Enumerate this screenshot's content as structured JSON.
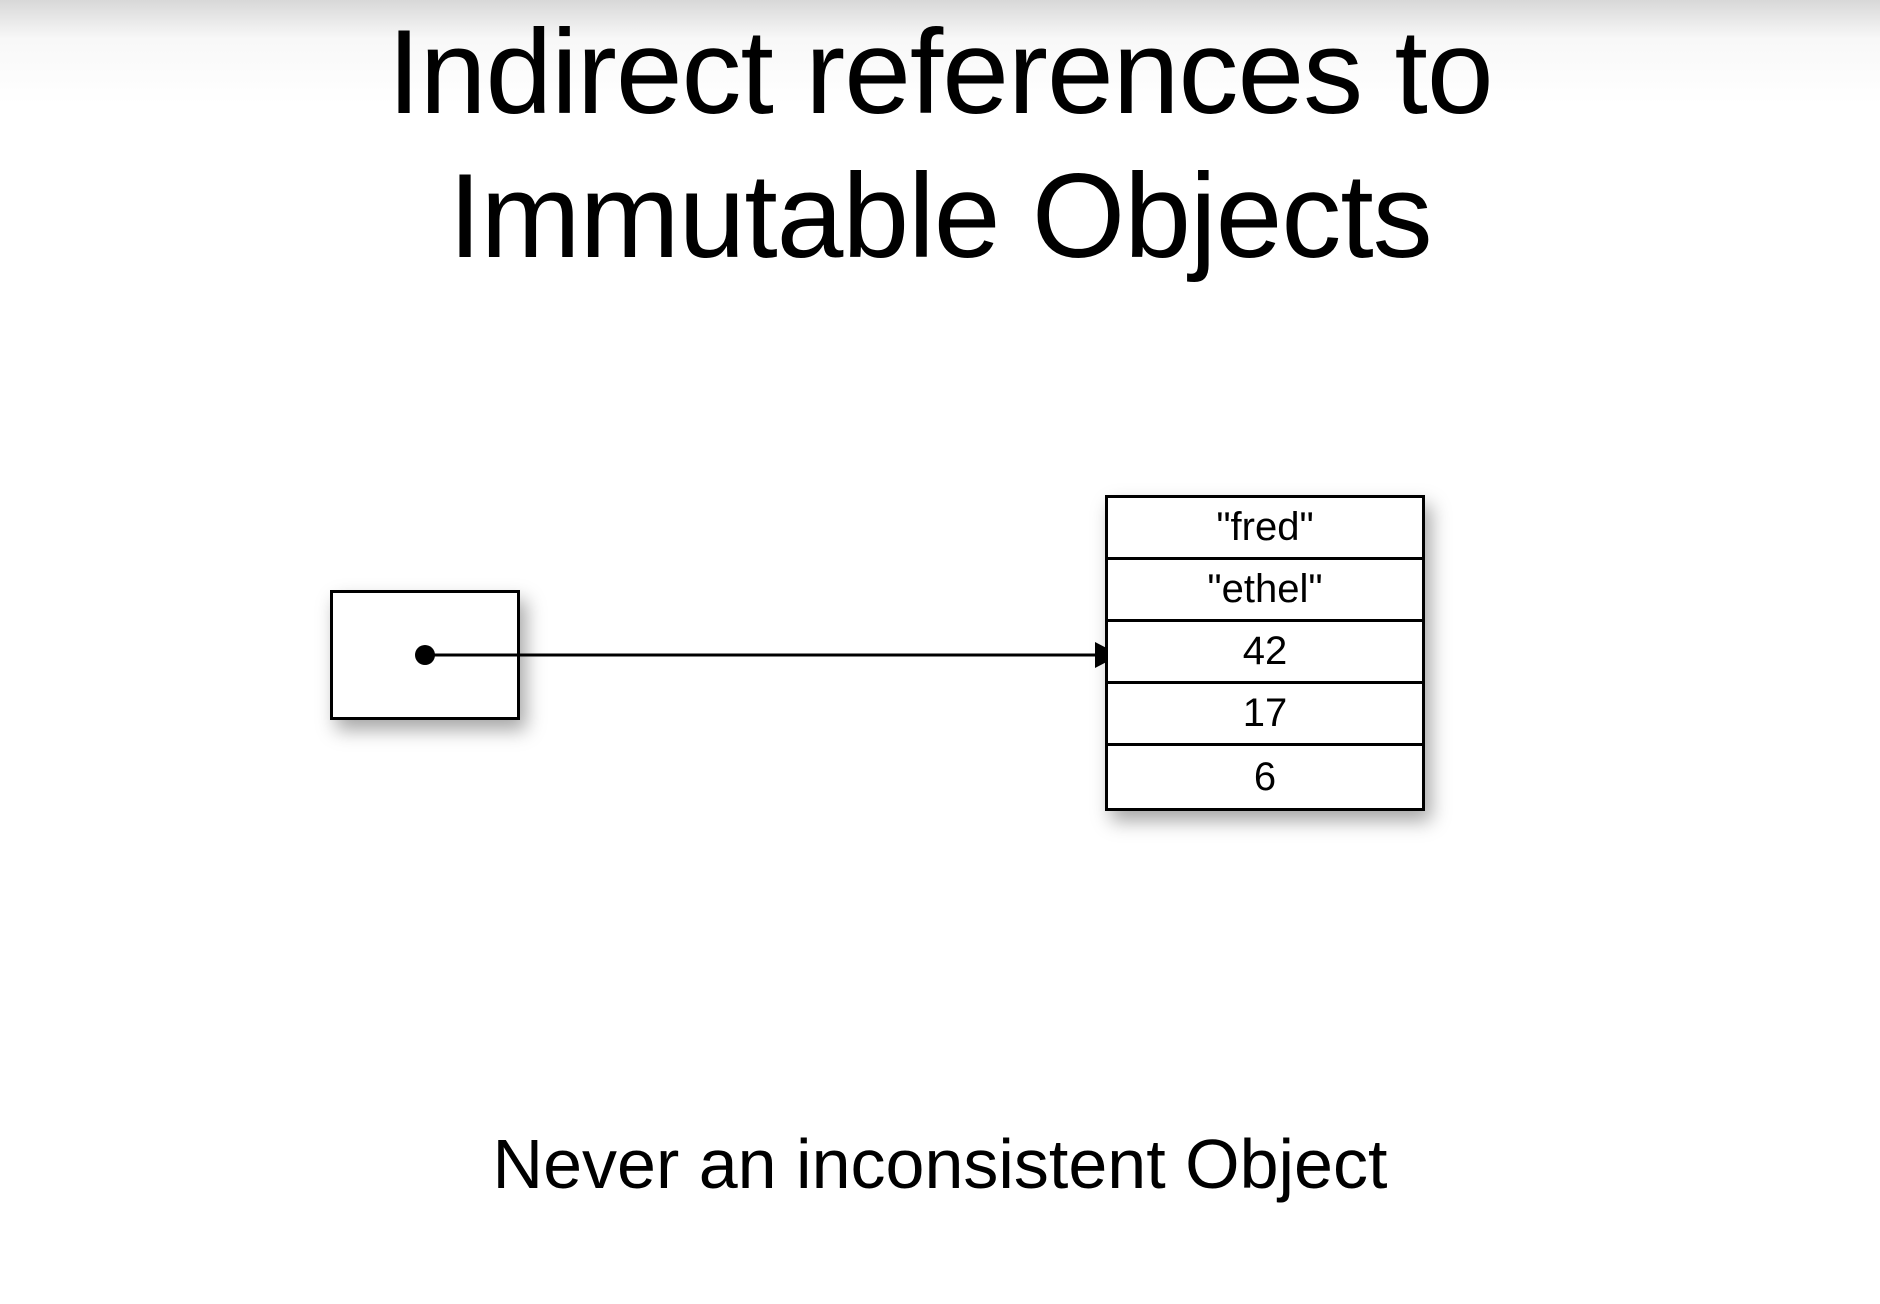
{
  "title_line1": "Indirect references to",
  "title_line2": "Immutable Objects",
  "object_rows": {
    "r0": "\"fred\"",
    "r1": "\"ethel\"",
    "r2": "42",
    "r3": "17",
    "r4": "6"
  },
  "footer": "Never an inconsistent Object"
}
